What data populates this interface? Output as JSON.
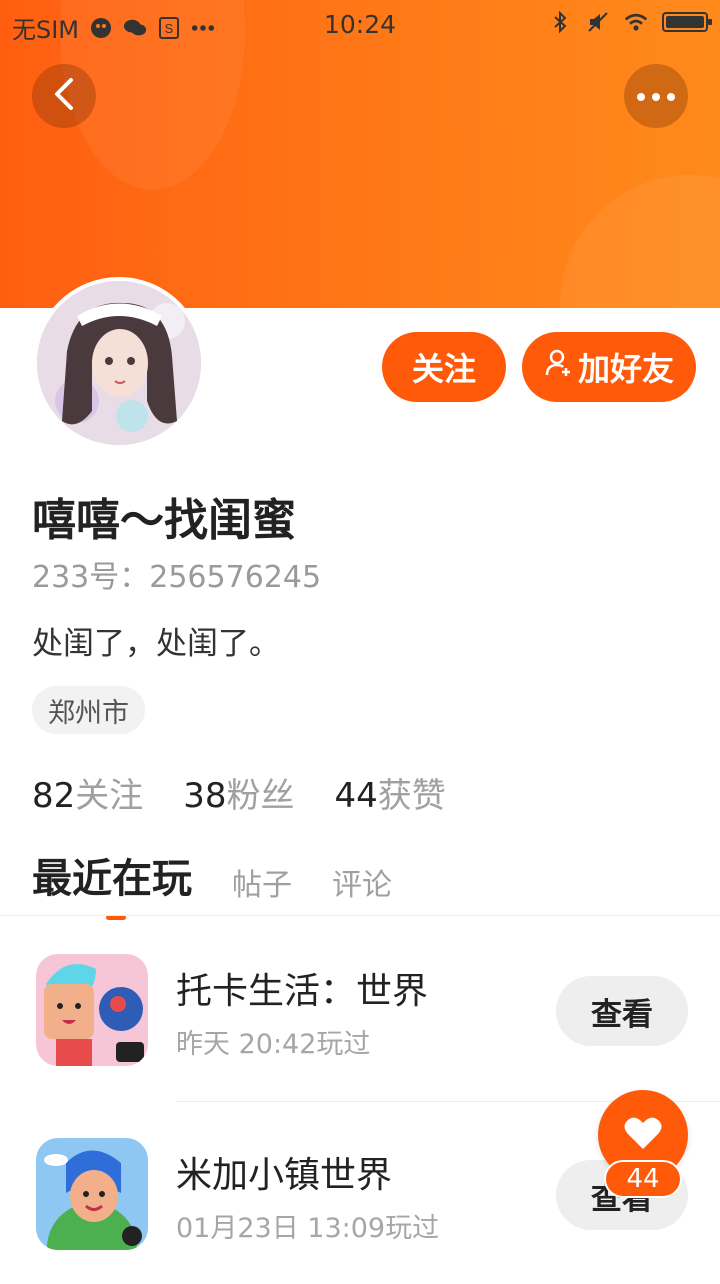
{
  "status_bar": {
    "carrier": "无SIM",
    "time": "10:24"
  },
  "profile": {
    "name": "嘻嘻～找闺蜜",
    "id_line": "233号：256576245",
    "bio": "处闺了，处闺了。",
    "location": "郑州市"
  },
  "actions": {
    "follow_label": "关注",
    "add_friend_label": "加好友"
  },
  "stats": [
    {
      "num": "82",
      "label": "关注"
    },
    {
      "num": "38",
      "label": "粉丝"
    },
    {
      "num": "44",
      "label": "获赞"
    }
  ],
  "tabs": {
    "active": "最近在玩",
    "posts": "帖子",
    "comments": "评论"
  },
  "games": [
    {
      "title": "托卡生活：世界",
      "time": "昨天 20:42玩过",
      "button": "查看"
    },
    {
      "title": "米加小镇世界",
      "time": "01月23日 13:09玩过",
      "button": "查看"
    }
  ],
  "like_float": {
    "count": "44"
  },
  "colors": {
    "accent": "#ff5a0a",
    "header_gradient_start": "#ff5e11",
    "header_gradient_end": "#ff8a1c"
  }
}
